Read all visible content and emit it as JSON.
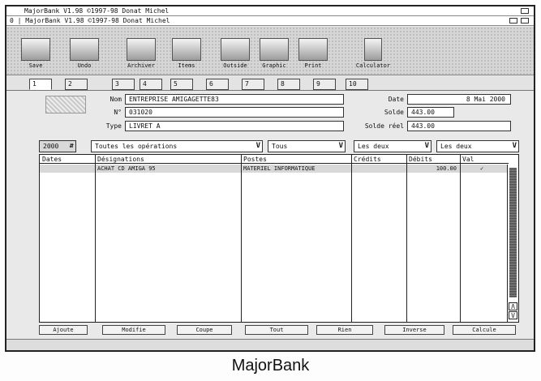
{
  "window": {
    "title": "MajorBank V1.98 ©1997-98 Donat Michel",
    "doc_title": "0 | MajorBank V1.98 ©1997-98 Donat Michel"
  },
  "toolbar": [
    {
      "label": "Save",
      "icon": "save-icon"
    },
    {
      "label": "Undo",
      "icon": "copy-icon"
    },
    {
      "label": "Archiver",
      "icon": "archive-book-icon"
    },
    {
      "label": "Items",
      "icon": "window-icon"
    },
    {
      "label": "Outside",
      "icon": "pen-icon"
    },
    {
      "label": "Graphic",
      "icon": "disk-icon"
    },
    {
      "label": "Print",
      "icon": "printer-icon"
    },
    {
      "label": "Calculator",
      "icon": "calculator-icon"
    }
  ],
  "tabs": [
    "1",
    "2",
    "3",
    "4",
    "5",
    "6",
    "7",
    "8",
    "9",
    "10"
  ],
  "account": {
    "name_label": "Nom",
    "name": "ENTREPRISE AMIGAGETTE83",
    "number_label": "N°",
    "number": "031020",
    "type_label": "Type",
    "type": "LIVRET A",
    "date_label": "Date",
    "date": "8 Mai 2000",
    "balance_label": "Solde",
    "balance": "443.00",
    "real_balance_label": "Solde réel",
    "real_balance": "443.00"
  },
  "filters": {
    "year": "2000",
    "operations": "Toutes les opérations",
    "scope": "Tous",
    "side": "Les deux",
    "side2": "Les deux"
  },
  "table": {
    "columns": [
      "Dates",
      "Désignations",
      "Postes",
      "Crédits",
      "Débits",
      "Val"
    ],
    "rows": [
      {
        "date": "",
        "designation": "ACHAT CD AMIGA 95",
        "poste": "MATERIEL INFORMATIQUE",
        "credit": "",
        "debit": "100.00",
        "val": "✓"
      }
    ]
  },
  "buttons": [
    "Ajoute",
    "Modifie",
    "Coupe",
    "Tout",
    "Rien",
    "Inverse",
    "Calcule"
  ],
  "caption": "MajorBank"
}
